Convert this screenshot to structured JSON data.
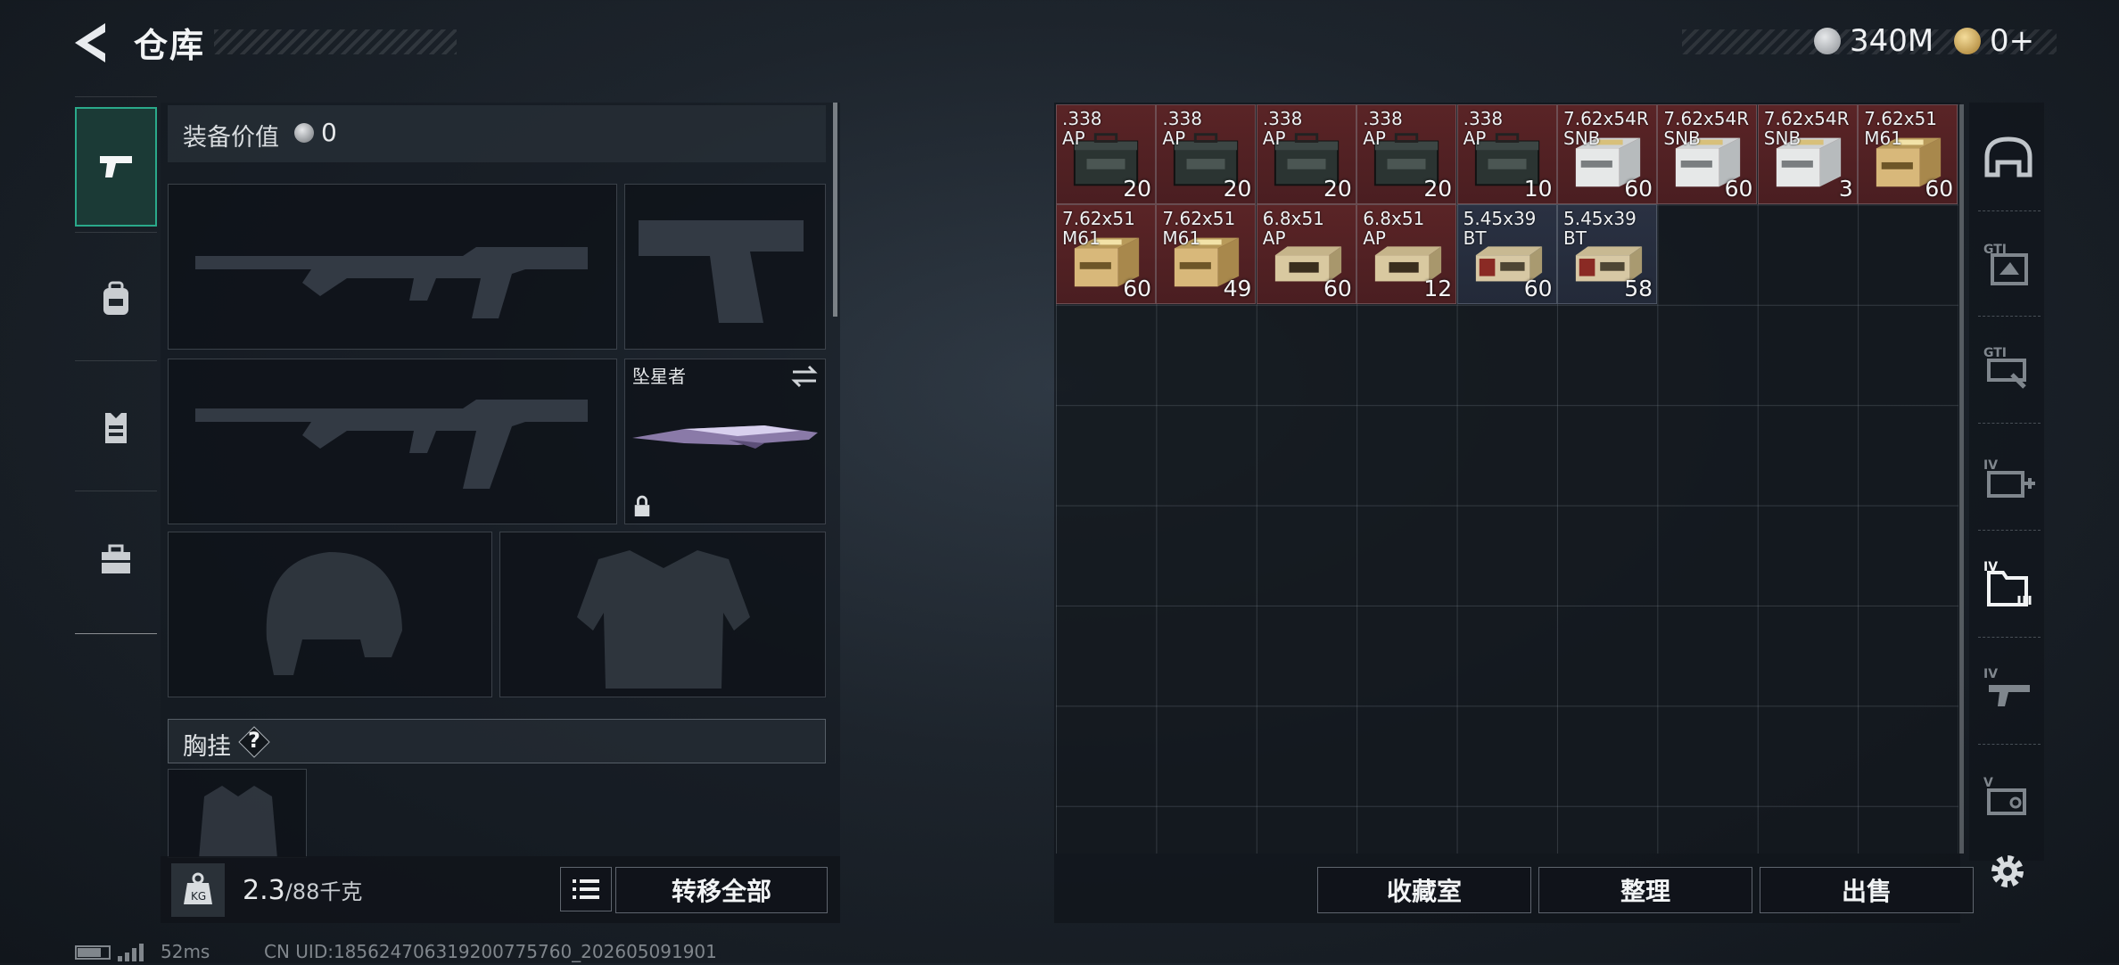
{
  "header": {
    "title": "仓库"
  },
  "currency": [
    {
      "icon": "silver-coin-icon",
      "value": "340M"
    },
    {
      "icon": "gold-coin-icon",
      "value": "0+"
    }
  ],
  "left_tabs": [
    {
      "icon": "pistol-icon",
      "active": true
    },
    {
      "icon": "backpack-icon",
      "active": false
    },
    {
      "icon": "vest-icon",
      "active": false
    },
    {
      "icon": "toolbox-icon",
      "active": false
    }
  ],
  "equipment": {
    "value_label": "装备价值",
    "value": "0",
    "melee_name": "坠星者",
    "chest_label": "胸挂",
    "help": "?"
  },
  "weight": {
    "current": "2.3",
    "max": "/88千克"
  },
  "buttons": {
    "transfer_all": "转移全部",
    "collection": "收藏室",
    "sort": "整理",
    "sell": "出售"
  },
  "items": [
    {
      "name": ".338\nAP",
      "qty": "20",
      "color": "red",
      "box": "ammo-can-icon"
    },
    {
      "name": ".338\nAP",
      "qty": "20",
      "color": "red",
      "box": "ammo-can-icon"
    },
    {
      "name": ".338\nAP",
      "qty": "20",
      "color": "red",
      "box": "ammo-can-icon"
    },
    {
      "name": ".338\nAP",
      "qty": "20",
      "color": "red",
      "box": "ammo-can-icon"
    },
    {
      "name": ".338\nAP",
      "qty": "10",
      "color": "red",
      "box": "ammo-can-icon"
    },
    {
      "name": "7.62x54R\nSNB",
      "qty": "60",
      "color": "red",
      "box": "white-ammo-box-icon"
    },
    {
      "name": "7.62x54R\nSNB",
      "qty": "60",
      "color": "red",
      "box": "white-ammo-box-icon"
    },
    {
      "name": "7.62x54R\nSNB",
      "qty": "3",
      "color": "red",
      "box": "white-ammo-box-icon"
    },
    {
      "name": "7.62x51\nM61",
      "qty": "60",
      "color": "red",
      "box": "tan-ammo-box-icon"
    },
    {
      "name": "7.62x51\nM61",
      "qty": "60",
      "color": "red",
      "box": "tan-ammo-box-icon"
    },
    {
      "name": "7.62x51\nM61",
      "qty": "49",
      "color": "red",
      "box": "tan-ammo-box-icon"
    },
    {
      "name": "6.8x51\nAP",
      "qty": "60",
      "color": "red",
      "box": "beige-ammo-box-icon"
    },
    {
      "name": "6.8x51\nAP",
      "qty": "12",
      "color": "red",
      "box": "beige-ammo-box-icon"
    },
    {
      "name": "5.45x39\nBT",
      "qty": "60",
      "color": "blue",
      "box": "small-ammo-box-icon"
    },
    {
      "name": "5.45x39\nBT",
      "qty": "58",
      "color": "blue",
      "box": "small-ammo-box-icon"
    }
  ],
  "right_tabs": [
    "helmet-tab-icon",
    "gti-case-icon",
    "gti-tool-icon",
    "iv-medkit-icon",
    "iv-folder-icon",
    "iv-gun-icon",
    "v-case-icon"
  ],
  "status_bar": {
    "ping": "52ms",
    "uid": "CN UID:18562470631920077576​0_202605091901"
  }
}
